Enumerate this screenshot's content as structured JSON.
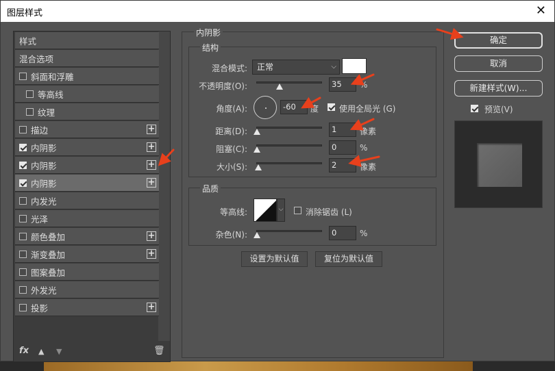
{
  "window": {
    "title": "图层样式",
    "close_icon": "close-icon"
  },
  "styles": {
    "header": "样式",
    "blend_options": "混合选项",
    "items": [
      {
        "label": "斜面和浮雕",
        "checked": false,
        "plus": false,
        "indent": false
      },
      {
        "label": "等高线",
        "checked": false,
        "plus": false,
        "indent": true
      },
      {
        "label": "纹理",
        "checked": false,
        "plus": false,
        "indent": true
      },
      {
        "label": "描边",
        "checked": false,
        "plus": true,
        "indent": false
      },
      {
        "label": "内阴影",
        "checked": true,
        "plus": true,
        "indent": false
      },
      {
        "label": "内阴影",
        "checked": true,
        "plus": true,
        "indent": false
      },
      {
        "label": "内阴影",
        "checked": true,
        "plus": true,
        "indent": false,
        "selected": true
      },
      {
        "label": "内发光",
        "checked": false,
        "plus": false,
        "indent": false
      },
      {
        "label": "光泽",
        "checked": false,
        "plus": false,
        "indent": false
      },
      {
        "label": "颜色叠加",
        "checked": false,
        "plus": true,
        "indent": false
      },
      {
        "label": "渐变叠加",
        "checked": false,
        "plus": true,
        "indent": false
      },
      {
        "label": "图案叠加",
        "checked": false,
        "plus": false,
        "indent": false
      },
      {
        "label": "外发光",
        "checked": false,
        "plus": false,
        "indent": false
      },
      {
        "label": "投影",
        "checked": false,
        "plus": true,
        "indent": false
      }
    ],
    "footer": {
      "fx": "fx",
      "up": "▲",
      "down": "▼",
      "trash": "🗑"
    }
  },
  "panel": {
    "title": "内阴影",
    "structure": {
      "title": "结构",
      "blend_mode_label": "混合模式:",
      "blend_mode_value": "正常",
      "opacity_label": "不透明度(O):",
      "opacity_value": "35",
      "opacity_unit": "%",
      "angle_label": "角度(A):",
      "angle_value": "-60",
      "angle_unit": "度",
      "global_light_label": "使用全局光 (G)",
      "global_light_checked": true,
      "distance_label": "距离(D):",
      "distance_value": "1",
      "distance_unit": "像素",
      "choke_label": "阻塞(C):",
      "choke_value": "0",
      "choke_unit": "%",
      "size_label": "大小(S):",
      "size_value": "2",
      "size_unit": "像素"
    },
    "quality": {
      "title": "品质",
      "contour_label": "等高线:",
      "antialias_label": "消除锯齿 (L)",
      "antialias_checked": false,
      "noise_label": "杂色(N):",
      "noise_value": "0",
      "noise_unit": "%"
    },
    "make_default": "设置为默认值",
    "reset_default": "复位为默认值"
  },
  "actions": {
    "ok": "确定",
    "cancel": "取消",
    "new_style": "新建样式(W)...",
    "preview_label": "预览(V)",
    "preview_checked": true
  },
  "colors": {
    "annotation_arrow": "#e8401c",
    "dialog_bg": "#535353"
  }
}
